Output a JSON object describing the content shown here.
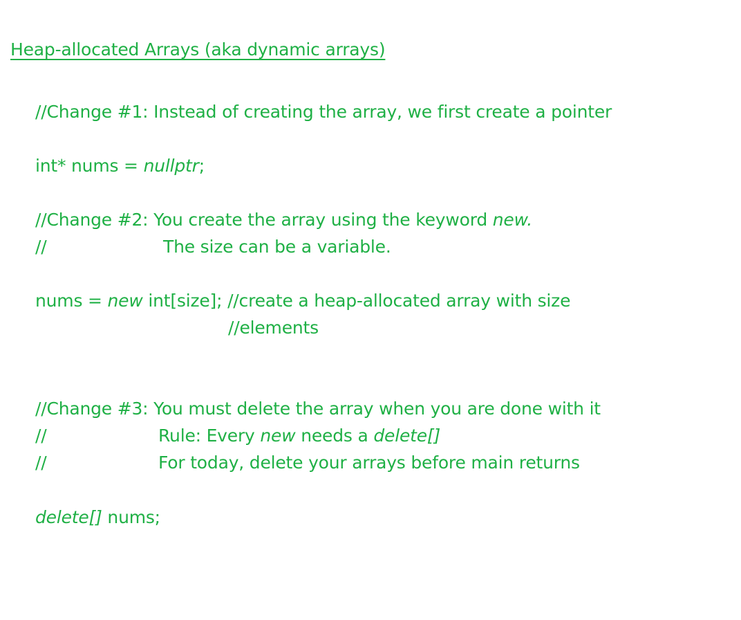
{
  "title": "Heap-allocated Arrays (aka dynamic arrays)",
  "change1": {
    "comment": "//Change #1: Instead of creating the array, we first create a pointer",
    "code_prefix": "int* nums = ",
    "code_italic": "nullptr",
    "code_suffix": ";"
  },
  "change2": {
    "comment_prefix": "//Change #2: You create the array using the keyword ",
    "comment_italic": "new.",
    "comment2_slashes": "//",
    "comment2_text": "The size can be a variable.",
    "code_prefix": "nums = ",
    "code_italic": "new",
    "code_suffix": " int[size]; //create a heap-allocated array with size",
    "code_cont": "//elements"
  },
  "change3": {
    "comment": "//Change #3: You must delete the array when you are done with it",
    "rule_slashes": "//",
    "rule_prefix": "Rule: Every ",
    "rule_italic_new": "new",
    "rule_middle": " needs a ",
    "rule_italic_delete": "delete[]",
    "today_slashes": "//",
    "today_text": "For today, delete your arrays before main returns",
    "code_italic": "delete[]",
    "code_suffix": " nums;"
  },
  "colors": {
    "text": "#1fb045"
  }
}
